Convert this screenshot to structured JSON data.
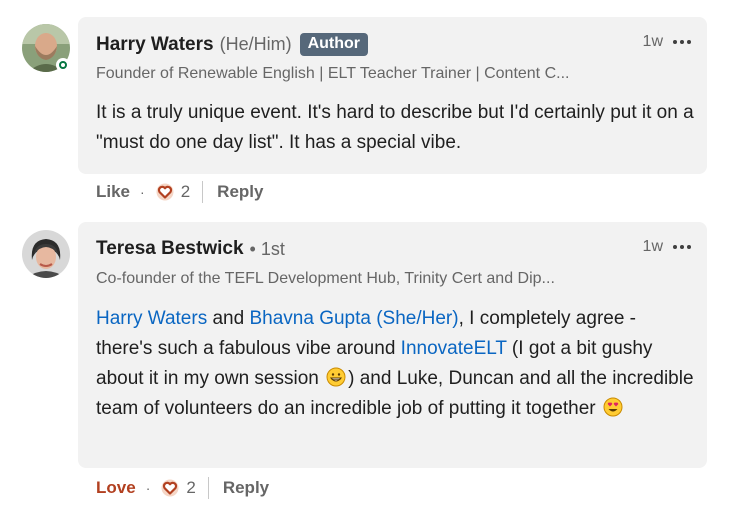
{
  "comments": [
    {
      "author": "Harry Waters",
      "pronouns": "(He/Him)",
      "badge": "Author",
      "headline": "Founder of Renewable English | ELT Teacher Trainer | Content C...",
      "timestamp": "1w",
      "body": "It is a truly unique event. It's hard to describe but I'd certainly put it on a \"must do one day list\". It has a special vibe.",
      "reaction_label": "Like",
      "reaction_count": "2",
      "reply_label": "Reply",
      "online": true
    },
    {
      "author": "Teresa Bestwick",
      "degree_dot": "•",
      "degree": "1st",
      "headline": "Co-founder of the TEFL Development Hub, Trinity Cert and Dip...",
      "timestamp": "1w",
      "body": {
        "mention_1": "Harry Waters",
        "text_1": " and ",
        "mention_2": "Bhavna Gupta (She/Her)",
        "text_2": ", I completely agree - there's such a fabulous vibe around ",
        "mention_3": "InnovateELT",
        "text_3": " (I got a bit gushy about it in my own session ",
        "text_4": ") and Luke, Duncan and all the incredible team of volunteers do an incredible job of putting it together "
      },
      "reaction_label": "Love",
      "reaction_count": "2",
      "reply_label": "Reply"
    }
  ],
  "separator_dot": "·",
  "icons": {
    "avatar_1": "avatar-photo",
    "avatar_2": "avatar-photo",
    "more": "more-horizontal-icon",
    "reaction": "heart-reaction-icon",
    "emoji_1": "grinning-face-emoji",
    "emoji_2": "heart-eyes-emoji"
  },
  "colors": {
    "link": "#0a66c2",
    "love": "#b24020",
    "online": "#057642",
    "badge": "#56687a"
  }
}
